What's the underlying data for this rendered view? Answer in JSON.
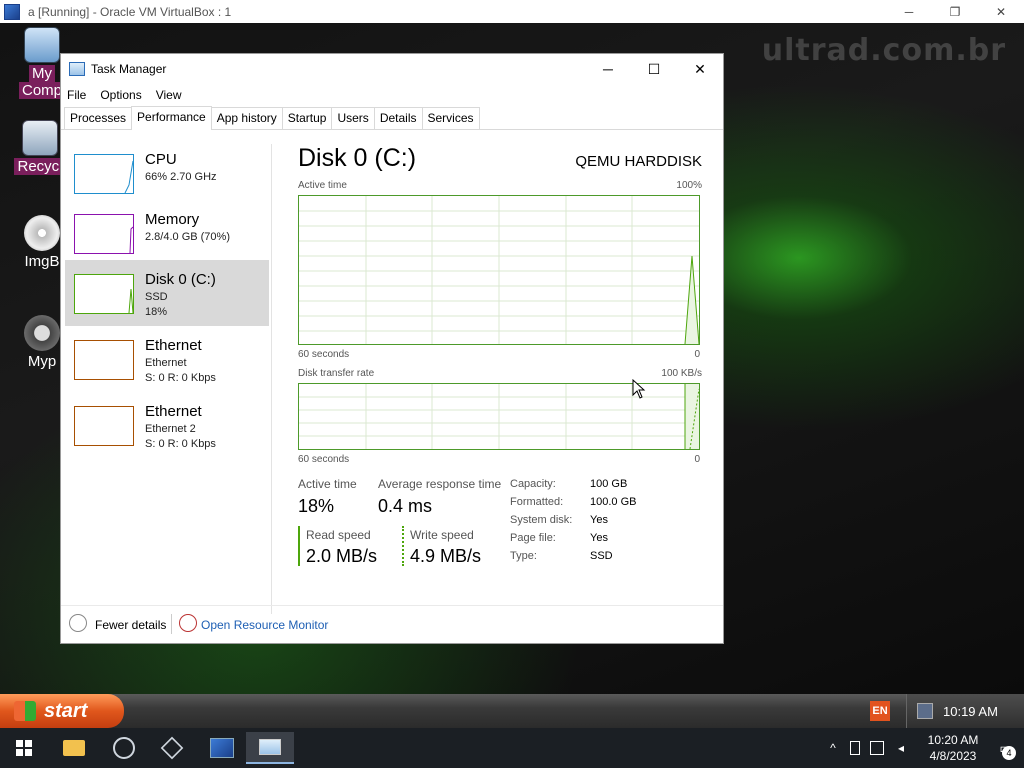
{
  "host_window": {
    "title": "a [Running] - Oracle VM VirtualBox : 1",
    "minimize": "─",
    "restore": "❐",
    "close": "✕"
  },
  "desktop": {
    "watermark": "ultrad.com.br",
    "icons": [
      {
        "label": "My",
        "label2": "Comp",
        "icon": "computer-icon"
      },
      {
        "label": "Recycl",
        "icon": "recycle-bin-icon"
      },
      {
        "label": "ImgB",
        "icon": "disc-icon"
      },
      {
        "label": "Myp",
        "icon": "raccoon-icon"
      }
    ]
  },
  "task_manager": {
    "title": "Task Manager",
    "controls": {
      "minimize": "─",
      "maximize": "☐",
      "close": "✕"
    },
    "menu": [
      "File",
      "Options",
      "View"
    ],
    "tabs": [
      "Processes",
      "Performance",
      "App history",
      "Startup",
      "Users",
      "Details",
      "Services"
    ],
    "active_tab": "Performance",
    "resources": [
      {
        "name": "CPU",
        "sub1": "66% 2.70 GHz",
        "sub2": "",
        "color": "#1f8ecd"
      },
      {
        "name": "Memory",
        "sub1": "2.8/4.0 GB (70%)",
        "sub2": "",
        "color": "#8b12ae"
      },
      {
        "name": "Disk 0 (C:)",
        "sub1": "SSD",
        "sub2": "18%",
        "color": "#4da60c"
      },
      {
        "name": "Ethernet",
        "sub1": "Ethernet",
        "sub2": "S: 0 R: 0 Kbps",
        "color": "#a74f01"
      },
      {
        "name": "Ethernet",
        "sub1": "Ethernet 2",
        "sub2": "S: 0 R: 0 Kbps",
        "color": "#a74f01"
      }
    ],
    "selected_resource": "Disk 0 (C:)",
    "detail": {
      "title": "Disk 0 (C:)",
      "model": "QEMU HARDDISK",
      "graph1": {
        "label": "Active time",
        "max": "100%",
        "xlabel": "60 seconds",
        "min": "0"
      },
      "graph2": {
        "label": "Disk transfer rate",
        "max": "100 KB/s",
        "xlabel": "60 seconds",
        "min": "0"
      },
      "active_time_label": "Active time",
      "active_time_value": "18%",
      "avg_response_label": "Average response time",
      "avg_response_value": "0.4 ms",
      "read_label": "Read speed",
      "read_value": "2.0 MB/s",
      "write_label": "Write speed",
      "write_value": "4.9 MB/s",
      "properties": [
        {
          "key": "Capacity:",
          "value": "100 GB"
        },
        {
          "key": "Formatted:",
          "value": "100.0 GB"
        },
        {
          "key": "System disk:",
          "value": "Yes"
        },
        {
          "key": "Page file:",
          "value": "Yes"
        },
        {
          "key": "Type:",
          "value": "SSD"
        }
      ]
    },
    "footer": {
      "fewer_details": "Fewer details",
      "open_resource_monitor": "Open Resource Monitor"
    }
  },
  "guest_taskbar": {
    "start_label": "start",
    "lang": "EN",
    "time": "10:19 AM"
  },
  "host_taskbar": {
    "time": "10:20 AM",
    "date": "4/8/2023",
    "notifications": "4"
  }
}
